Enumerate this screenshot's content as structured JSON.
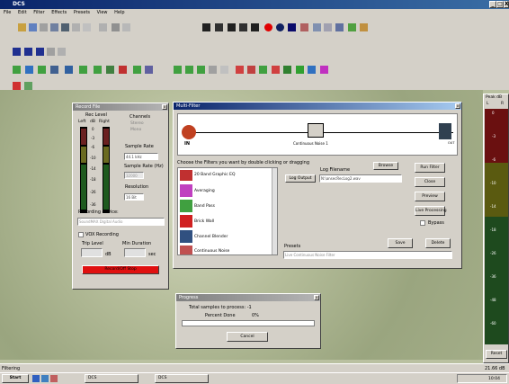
{
  "app": {
    "title": "DCS",
    "controls": [
      "_",
      "□",
      "X"
    ]
  },
  "menu": [
    "File",
    "Edit",
    "Filter",
    "Effects",
    "Presets",
    "View",
    "Help"
  ],
  "record": {
    "title": "Record File",
    "rec_level": "Rec Level",
    "left": "Left",
    "db": "dB",
    "right": "Right",
    "channels": "Channels",
    "stereo": "Stereo",
    "mono": "Mono",
    "scale": [
      "0",
      "-3",
      "-6",
      "-10",
      "-14",
      "-18",
      "-26",
      "-36"
    ],
    "sample_rate_label": "Sample Rate",
    "sample_rate_value": "44.1 kHz",
    "sample_rate_hz_label": "Sample Rate (Hz)",
    "sample_rate_hz_value": "32000",
    "resolution_label": "Resolution",
    "resolution_value": "16 Bit",
    "device_label": "Recording device:",
    "device_value": "SoundMAX Digital Audio",
    "vox": "VOX Recording",
    "trip_level": "Trip Level",
    "min_duration": "Min Duration",
    "db_unit": "dB",
    "sec_unit": "sec",
    "rec_button": "Record/Off Stop"
  },
  "filters": {
    "title": "Multi-Filter",
    "input_label": "IN",
    "output_label": "OUT",
    "block_label": "Continuous Noise 1",
    "instructions": "Choose the Filters you want by double clicking or dragging",
    "items": [
      "20 Band Graphic EQ",
      "Averaging",
      "Band Pass",
      "Brick Wall",
      "Channel Blender",
      "Continuous Noise"
    ],
    "log_filename_label": "Log Filename",
    "browse": "Browse",
    "log_output": "Log Output",
    "log_path": "N:\\ansecRecLog2.wav",
    "run_filter": "Run Filter",
    "close": "Close",
    "preview": "Preview",
    "live_processing": "Live Processing",
    "bypass": "Bypass",
    "save": "Save",
    "delete": "Delete",
    "presets_label": "Presets",
    "presets_value": "Live Continuous Noise Filter"
  },
  "progress": {
    "title": "Progress",
    "total_samples": "Total samples to process: -1",
    "percent_label": "Percent Done",
    "percent_value": "0%",
    "cancel": "Cancel"
  },
  "peak": {
    "title": "Peak dB",
    "left": "L",
    "right": "R",
    "scale": [
      "0",
      "-3",
      "-6",
      "-10",
      "-14",
      "-18",
      "-26",
      "-36",
      "-48",
      "-60"
    ],
    "reset": "Reset"
  },
  "status": {
    "text": "Filtering",
    "time": "21.66 dB"
  },
  "taskbar": {
    "start": "Start",
    "task1": "DCS",
    "task2": "DCS",
    "clock": "10:04"
  }
}
